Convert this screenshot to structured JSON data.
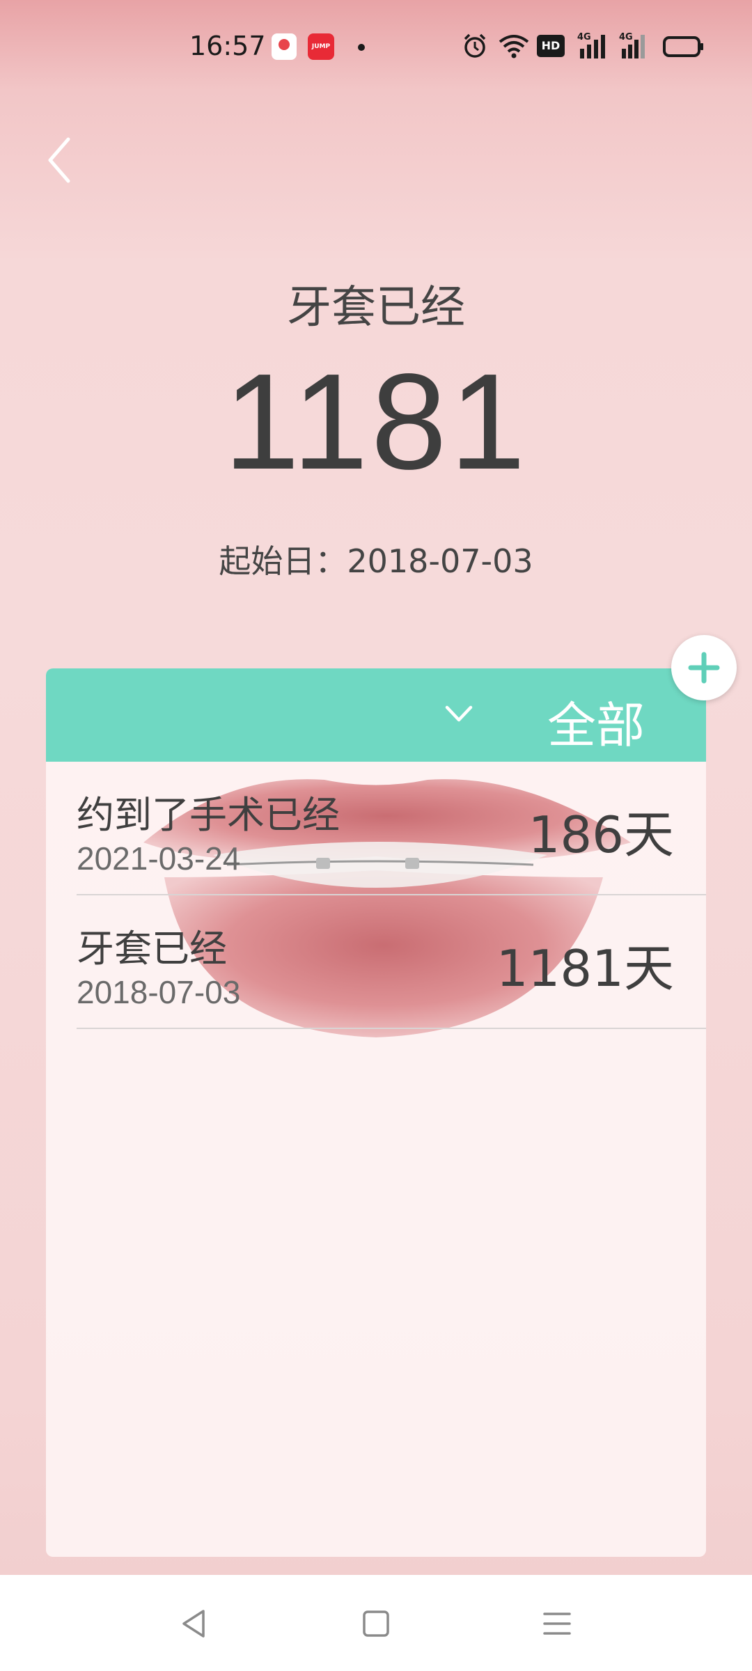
{
  "status_bar": {
    "time": "16:57",
    "app_icon_2": "JUMP",
    "hd_label": "HD",
    "sig1_label": "4G",
    "sig2_label": "4G",
    "icons": [
      "app-notification-icon",
      "jump-app-icon",
      "notification-dot-icon",
      "alarm-icon",
      "wifi-icon",
      "hd-icon",
      "signal-4g-icon",
      "signal-4g-icon",
      "battery-icon"
    ]
  },
  "header": {
    "back_icon": "chevron-left-icon",
    "title": "牙套已经",
    "count": "1181",
    "start_label": "起始日：2018-07-03"
  },
  "list": {
    "filter_label": "全部",
    "filter_icon": "chevron-down-icon",
    "add_icon": "plus-icon",
    "accent_color": "#6fd8c2",
    "items": [
      {
        "title": "约到了手术已经",
        "date": "2021-03-24",
        "days": "186天"
      },
      {
        "title": "牙套已经",
        "date": "2018-07-03",
        "days": "1181天"
      }
    ]
  },
  "nav_bar": {
    "icons": [
      "back-triangle-icon",
      "home-square-icon",
      "menu-lines-icon"
    ]
  }
}
